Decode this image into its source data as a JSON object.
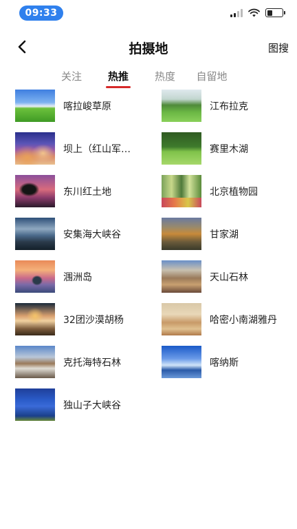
{
  "status_bar": {
    "time": "09:33",
    "time_color": "#2f80ed"
  },
  "header": {
    "title": "拍摄地",
    "right_action": "图搜",
    "back_icon": "chevron-left-icon"
  },
  "tabs": [
    {
      "label": "关注",
      "active": false
    },
    {
      "label": "热推",
      "active": true
    },
    {
      "label": "热度",
      "active": false
    },
    {
      "label": "自留地",
      "active": false
    }
  ],
  "accent_color": "#d62828",
  "locations": [
    {
      "name": "喀拉峻草原",
      "thumb": "grassland-photo"
    },
    {
      "name": "江布拉克",
      "thumb": "green-hills-photo"
    },
    {
      "name": "坝上（红山军…",
      "thumb": "sunset-lake-photo"
    },
    {
      "name": "赛里木湖",
      "thumb": "forest-meadow-photo"
    },
    {
      "name": "东川红土地",
      "thumb": "red-soil-tree-photo"
    },
    {
      "name": "北京植物园",
      "thumb": "flower-garden-photo"
    },
    {
      "name": "安集海大峡谷",
      "thumb": "canyon-photo"
    },
    {
      "name": "甘家湖",
      "thumb": "river-bend-photo"
    },
    {
      "name": "涠洲岛",
      "thumb": "island-sunset-photo"
    },
    {
      "name": "天山石林",
      "thumb": "stone-forest-photo"
    },
    {
      "name": "32团沙漠胡杨",
      "thumb": "desert-poplar-photo"
    },
    {
      "name": "哈密小南湖雅丹",
      "thumb": "yardang-photo"
    },
    {
      "name": "克托海特石林",
      "thumb": "rock-forest-photo"
    },
    {
      "name": "喀纳斯",
      "thumb": "snow-forest-photo"
    },
    {
      "name": "独山子大峡谷",
      "thumb": "dushanzi-canyon-photo"
    }
  ]
}
